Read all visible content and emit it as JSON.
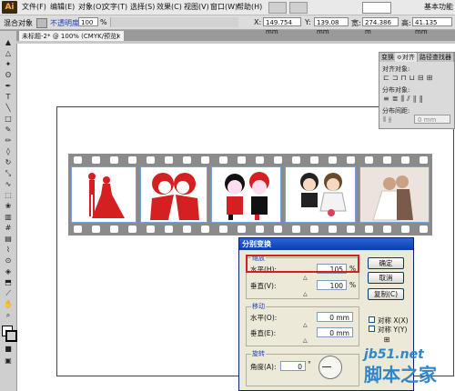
{
  "menubar": {
    "logo": "Ai",
    "items": [
      "文件(F)",
      "编辑(E)",
      "对象(O)",
      "文字(T)",
      "选择(S)",
      "效果(C)",
      "视图(V)",
      "窗口(W)",
      "帮助(H)"
    ],
    "workspace": "基本功能"
  },
  "control_bar": {
    "mode_label": "混合对象",
    "opacity_label": "不透明度:",
    "opacity_value": "100",
    "opacity_unit": "%",
    "x_label": "X:",
    "x_value": "149.754 mm",
    "y_label": "Y:",
    "y_value": "139.08 mm",
    "w_label": "宽:",
    "w_value": "274.386 m",
    "h_label": "高:",
    "h_value": "41.135 mm"
  },
  "document_tab": {
    "title": "未标题-2* @ 100% (CMYK/预览)",
    "close": "×"
  },
  "panel": {
    "tabs": [
      "变换",
      "≎对齐",
      "路径查找器"
    ],
    "align_objects_label": "对齐对象:",
    "distribute_objects_label": "分布对象:",
    "distribute_spacing_label": "分布间距:",
    "spacing_value": "0 mm"
  },
  "dialog": {
    "title": "分别变换",
    "scale_group": "缩放",
    "horizontal_label": "水平(H):",
    "horizontal_value": "105",
    "vertical_label": "垂直(V):",
    "vertical_value": "100",
    "percent": "%",
    "move_group": "移动",
    "move_h_label": "水平(O):",
    "move_h_value": "0 mm",
    "move_v_label": "垂直(E):",
    "move_v_value": "0 mm",
    "rotate_group": "旋转",
    "angle_label": "角度(A):",
    "angle_value": "0",
    "angle_unit": "°",
    "ok": "确定",
    "cancel": "取消",
    "copy": "复制(C)",
    "reflect_x": "对称 X(X)",
    "reflect_y": "对称 Y(Y)"
  },
  "watermark": {
    "domain": "jb51.net",
    "brand": "脚本之家"
  },
  "colors": {
    "accent_red": "#d21f1f",
    "dialog_title": "#0a3fa8",
    "film_gray": "#8b8b8b",
    "watermark_blue": "#2f86c9"
  }
}
